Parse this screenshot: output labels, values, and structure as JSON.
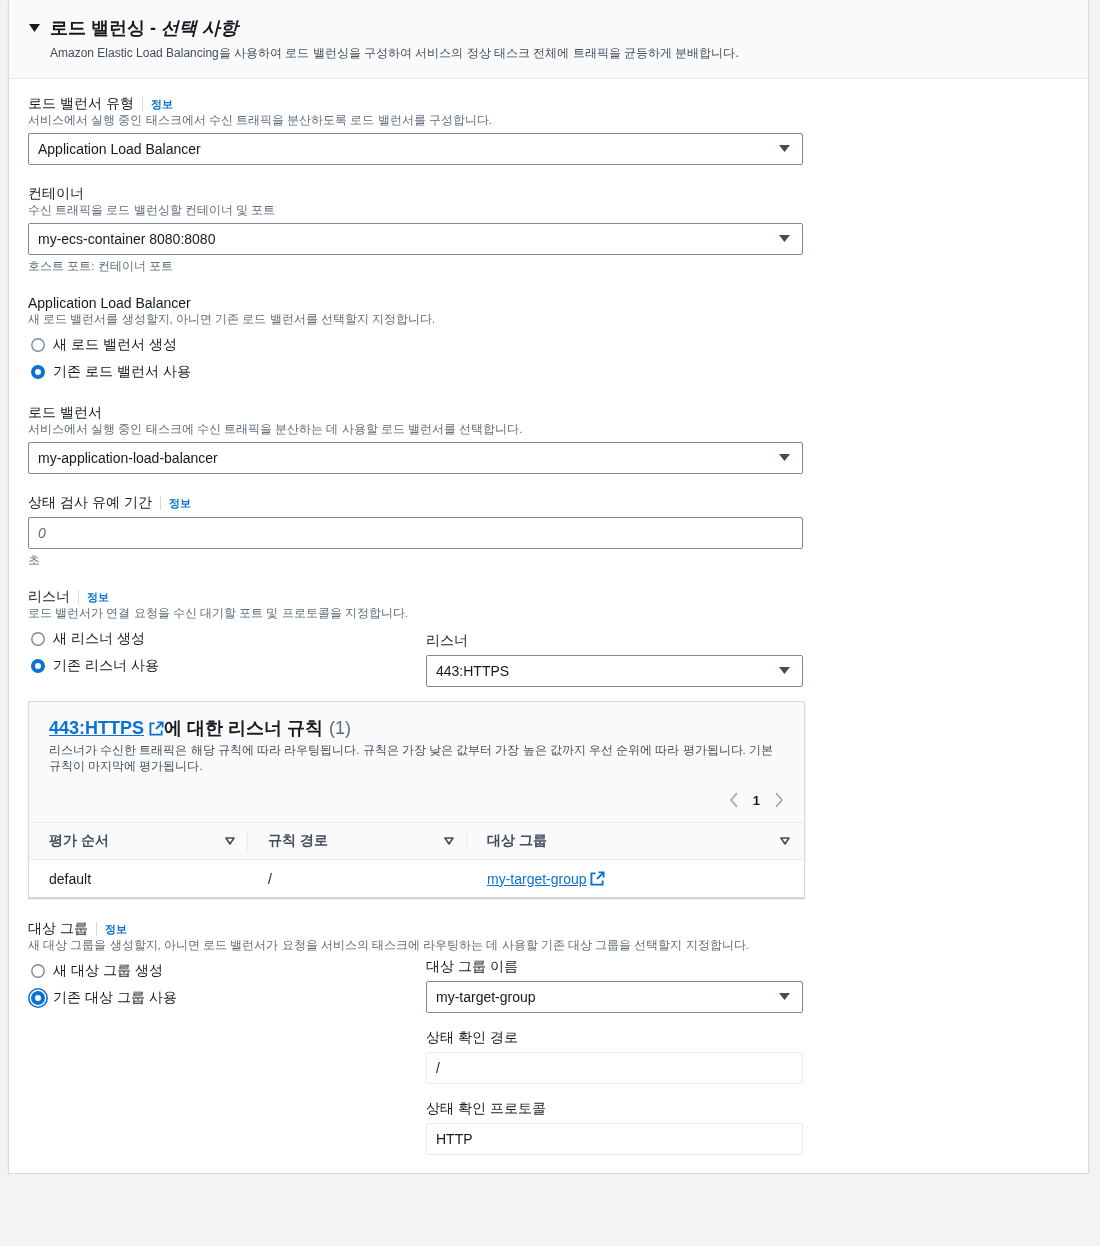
{
  "section": {
    "expanded": true,
    "title": "로드 밸런싱 - *선택 사항*",
    "description": "Amazon Elastic Load Balancing을 사용하여 로드 밸런싱을 구성하여 서비스의 정상 태스크 전체에 트래픽을 균등하게 분배합니다."
  },
  "load_balancer_type": {
    "label": "로드 밸런서 유형",
    "info": "정보",
    "description": "서비스에서 실행 중인 태스크에서 수신 트래픽을 분산하도록 로드 밸런서를 구성합니다.",
    "value": "Application Load Balancer"
  },
  "container": {
    "label": "컨테이너",
    "description": "수신 트래픽을 로드 밸런싱할 컨테이너 및 포트",
    "value": "my-ecs-container 8080:8080",
    "hint": "호스트 포트: 컨테이너 포트"
  },
  "alb": {
    "label": "Application Load Balancer",
    "description": "새 로드 밸런서를 생성할지, 아니면 기존 로드 밸런서를 선택할지 지정합니다.",
    "options": [
      {
        "label": "새 로드 밸런서 생성",
        "selected": false
      },
      {
        "label": "기존 로드 밸런서 사용",
        "selected": true
      }
    ]
  },
  "load_balancer": {
    "label": "로드 밸런서",
    "description": "서비스에서 실행 중인 태스크에 수신 트래픽을 분산하는 데 사용할 로드 밸런서를 선택합니다.",
    "value": "my-application-load-balancer"
  },
  "grace_period": {
    "label": "상태 검사 유예 기간",
    "info": "정보",
    "placeholder": "0",
    "unit": "초"
  },
  "listener": {
    "label": "리스너",
    "info": "정보",
    "description": "로드 밸런서가 연결 요청을 수신 대기할 포트 및 프로토콜을 지정합니다.",
    "options": [
      {
        "label": "새 리스너 생성",
        "selected": false
      },
      {
        "label": "기존 리스너 사용",
        "selected": true
      }
    ],
    "select_label": "리스너",
    "value": "443:HTTPS"
  },
  "listener_rules": {
    "link": "443:HTTPS",
    "title": "에 대한 리스너 규칙",
    "count": "(1)",
    "description": "리스너가 수신한 트래픽은 해당 규칙에 따라 라우팅됩니다. 규칙은 가장 낮은 값부터 가장 높은 값까지 우선 순위에 따라 평가됩니다. 기본 규칙이 마지막에 평가됩니다.",
    "page": "1",
    "columns": [
      "평가 순서",
      "규칙 경로",
      "대상 그룹"
    ],
    "rows": [
      {
        "cells": [
          {
            "kind": "text",
            "text": "default"
          },
          {
            "kind": "text",
            "text": "/"
          },
          {
            "kind": "link",
            "text": "my-target-group"
          }
        ]
      }
    ]
  },
  "target_group": {
    "label": "대상 그룹",
    "info": "정보",
    "description": "새 대상 그룹을 생성할지, 아니면 로드 밸런서가 요청을 서비스의 태스크에 라우팅하는 데 사용할 기존 대상 그룹을 선택할지 지정합니다.",
    "options": [
      {
        "label": "새 대상 그룹 생성",
        "selected": false,
        "focused": false
      },
      {
        "label": "기존 대상 그룹 사용",
        "selected": true,
        "focused": true
      }
    ],
    "name_label": "대상 그룹 이름",
    "name_value": "my-target-group",
    "health_path_label": "상태 확인 경로",
    "health_path_value": "/",
    "health_protocol_label": "상태 확인 프로토콜",
    "health_protocol_value": "HTTP"
  }
}
